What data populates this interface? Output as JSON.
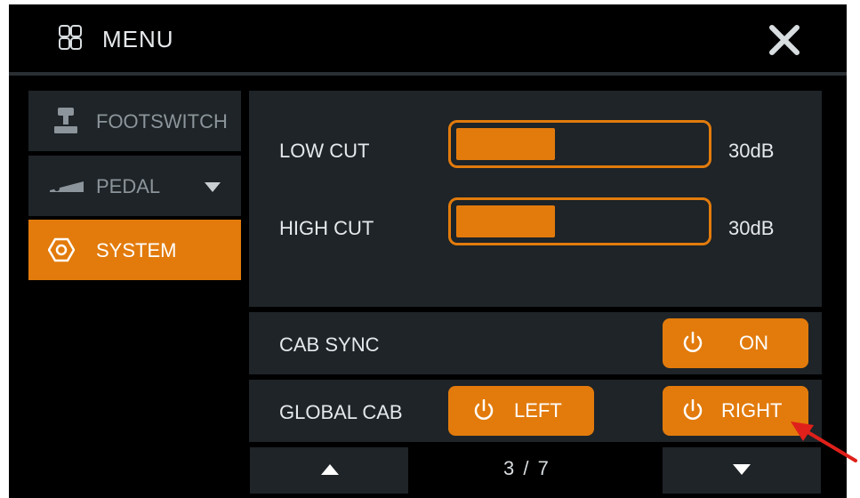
{
  "header": {
    "title": "MENU"
  },
  "sidebar": {
    "items": [
      {
        "label": "FOOTSWITCH",
        "icon": "footswitch-icon",
        "active": false
      },
      {
        "label": "PEDAL",
        "icon": "pedal-icon",
        "active": false,
        "has_dropdown": true
      },
      {
        "label": "SYSTEM",
        "icon": "hexagon-settings-icon",
        "active": true
      }
    ]
  },
  "eq": {
    "low_cut": {
      "label": "LOW CUT",
      "value": "30dB",
      "level": 0.4
    },
    "high_cut": {
      "label": "HIGH CUT",
      "value": "30dB",
      "level": 0.4
    }
  },
  "cab_sync": {
    "label": "CAB SYNC",
    "button": "ON"
  },
  "global_cab": {
    "label": "GLOBAL CAB",
    "left": "LEFT",
    "right": "RIGHT"
  },
  "pagination": {
    "indicator": "3 / 7"
  },
  "colors": {
    "accent": "#e27b0c",
    "panel": "#1e2428",
    "background": "#000000",
    "annotation_arrow": "#e0201a"
  }
}
